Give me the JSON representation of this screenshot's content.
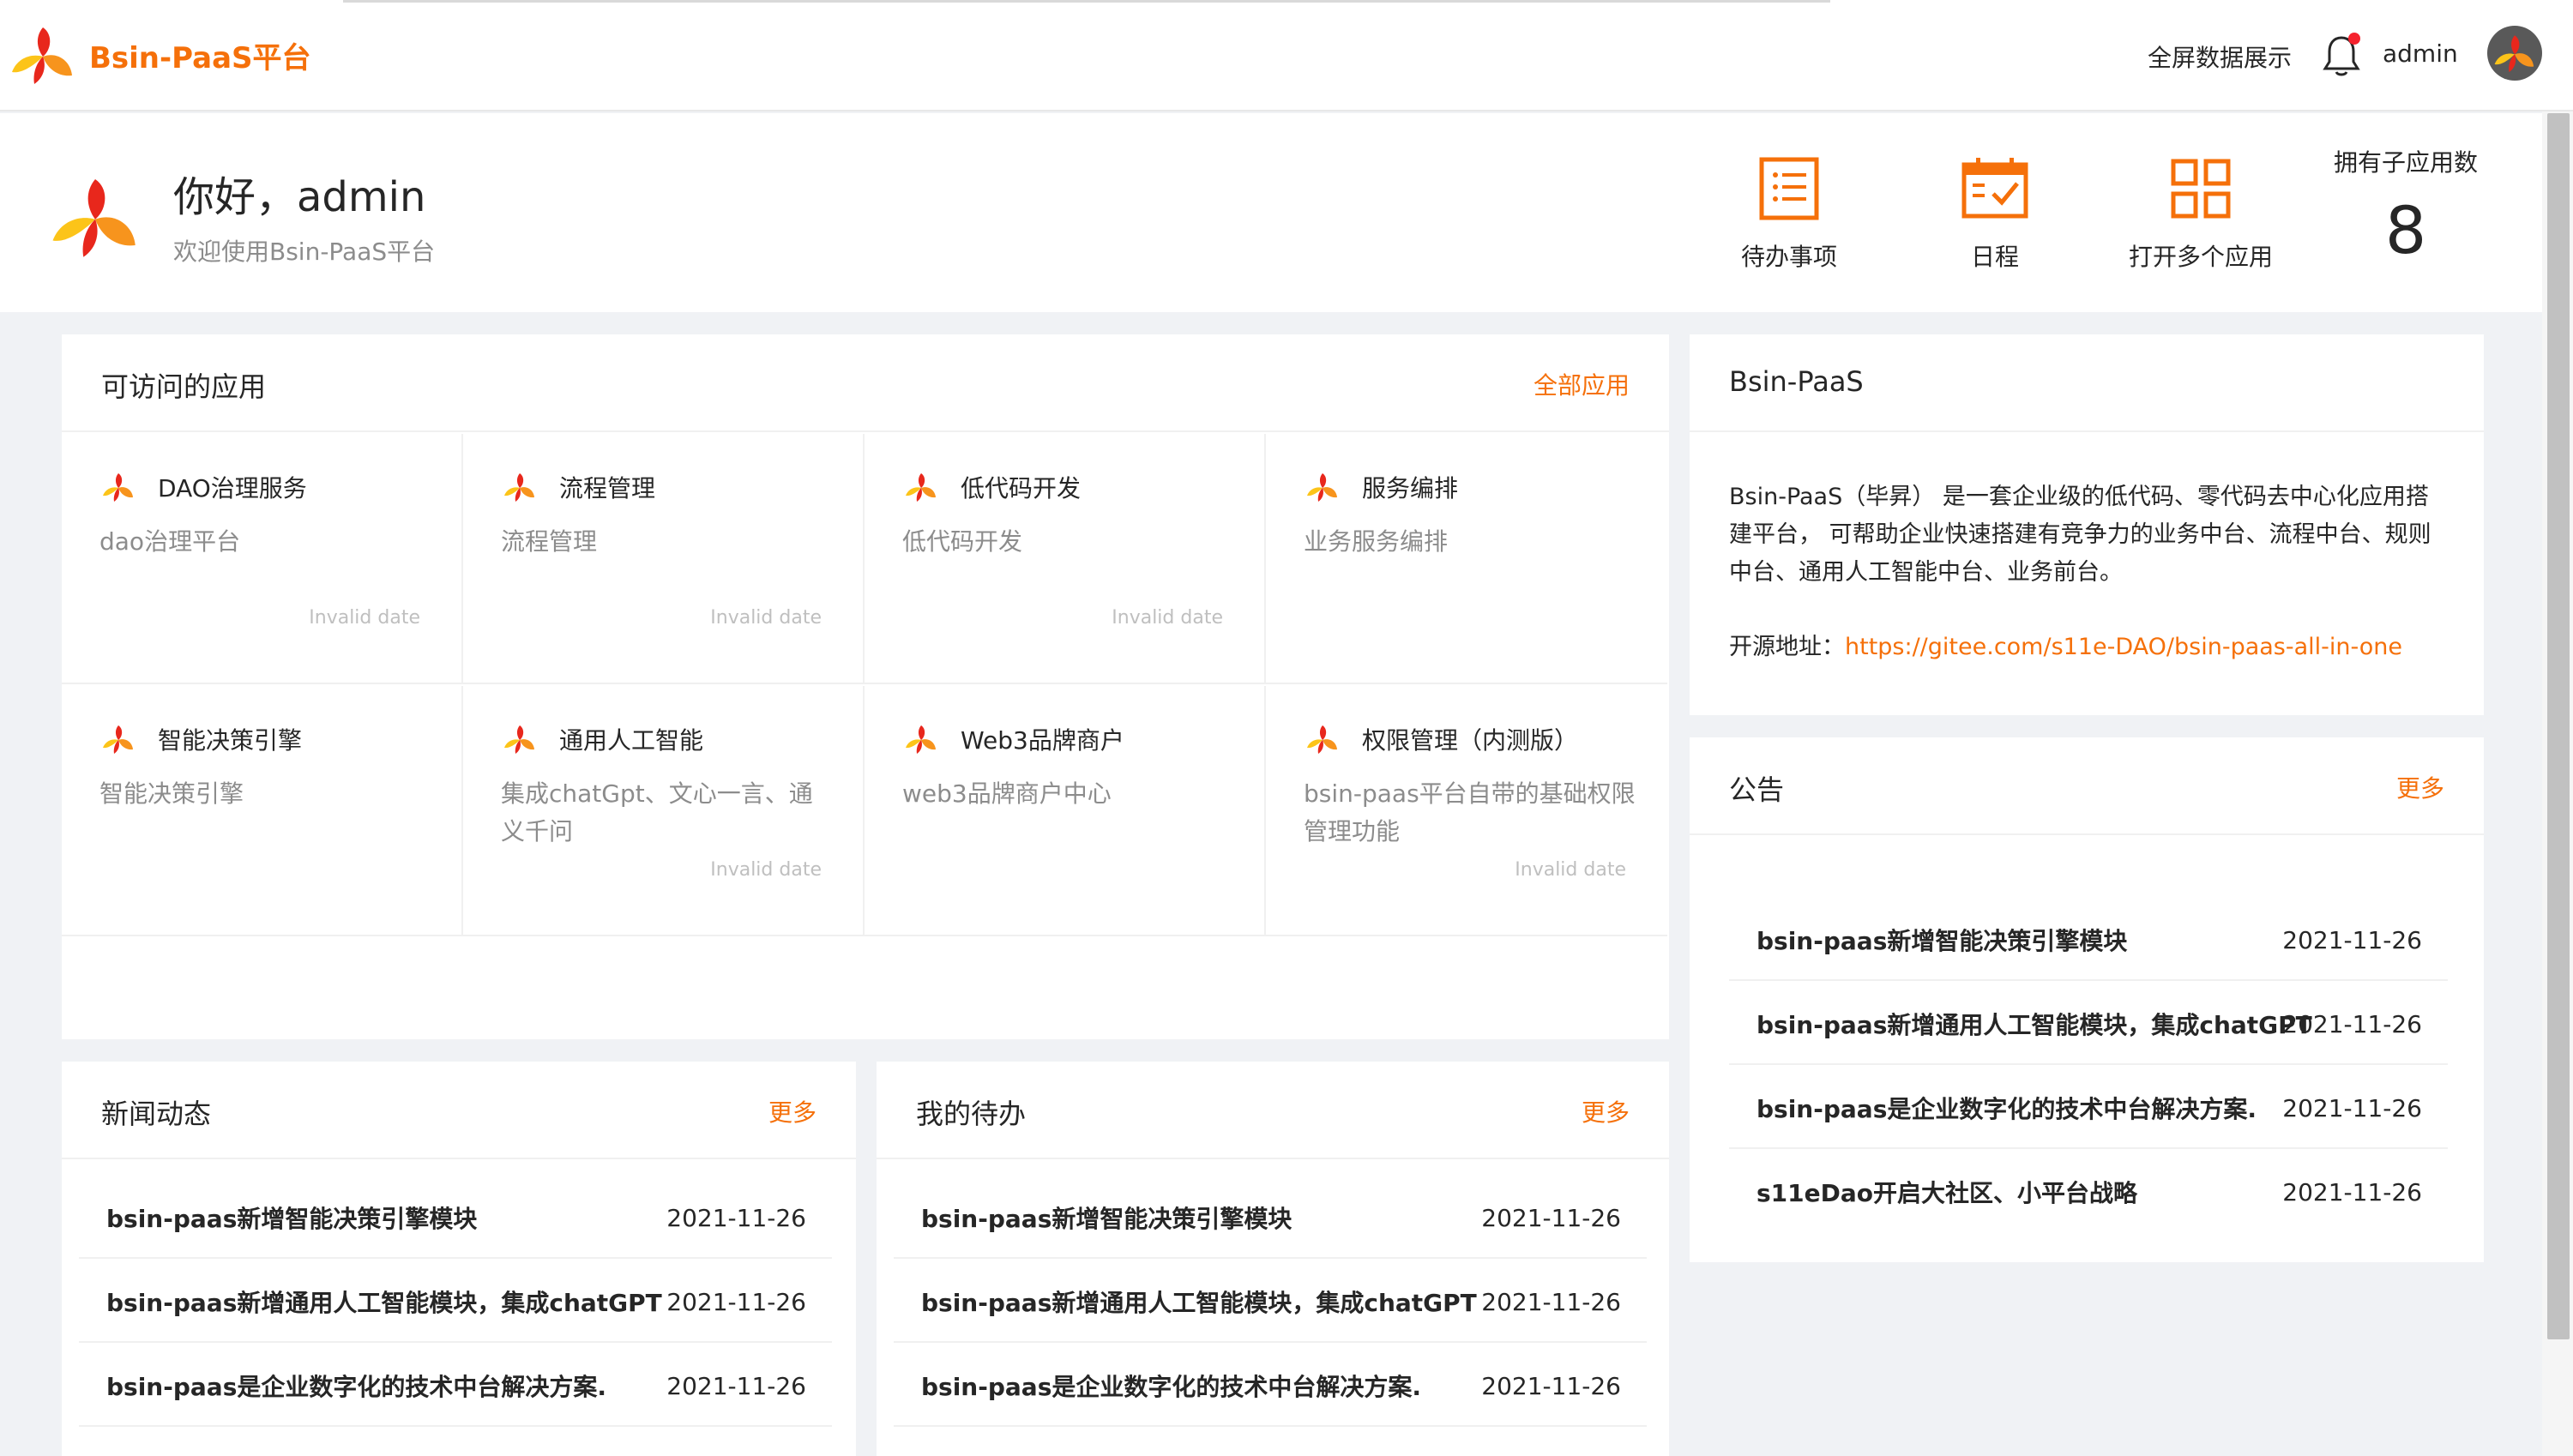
{
  "header": {
    "brand_name": "Bsin-PaaS平台",
    "fullscreen_label": "全屏数据展示",
    "username": "admin"
  },
  "welcome": {
    "greeting": "你好，admin",
    "subtitle": "欢迎使用Bsin-PaaS平台",
    "quick_actions": [
      {
        "label": "待办事项",
        "icon": "todo-list-icon"
      },
      {
        "label": "日程",
        "icon": "calendar-check-icon"
      },
      {
        "label": "打开多个应用",
        "icon": "grid-apps-icon"
      }
    ],
    "subapp_count_label": "拥有子应用数",
    "subapp_count": "8"
  },
  "apps": {
    "title": "可访问的应用",
    "more_label": "全部应用",
    "items": [
      {
        "name": "DAO治理服务",
        "desc": "dao治理平台",
        "date": "Invalid date"
      },
      {
        "name": "流程管理",
        "desc": "流程管理",
        "date": "Invalid date"
      },
      {
        "name": "低代码开发",
        "desc": "低代码开发",
        "date": "Invalid date"
      },
      {
        "name": "服务编排",
        "desc": "业务服务编排",
        "date": ""
      },
      {
        "name": "智能决策引擎",
        "desc": "智能决策引擎",
        "date": ""
      },
      {
        "name": "通用人工智能",
        "desc": "集成chatGpt、文心一言、通义千问",
        "date": "Invalid date"
      },
      {
        "name": "Web3品牌商户",
        "desc": "web3品牌商户中心",
        "date": ""
      },
      {
        "name": "权限管理（内测版）",
        "desc": "bsin-paas平台自带的基础权限管理功能",
        "date": "Invalid date"
      }
    ]
  },
  "about": {
    "title": "Bsin-PaaS",
    "body": "Bsin-PaaS（毕昇） 是一套企业级的低代码、零代码去中心化应用搭建平台， 可帮助企业快速搭建有竞争力的业务中台、流程中台、规则中台、通用人工智能中台、业务前台。",
    "link_label": "开源地址：",
    "link_url": "https://gitee.com/s11e-DAO/bsin-paas-all-in-one"
  },
  "notice": {
    "title": "公告",
    "more_label": "更多",
    "items": [
      {
        "title": "bsin-paas新增智能决策引擎模块",
        "date": "2021-11-26"
      },
      {
        "title": "bsin-paas新增通用人工智能模块，集成chatGPT",
        "date": "2021-11-26"
      },
      {
        "title": "bsin-paas是企业数字化的技术中台解决方案.",
        "date": "2021-11-26"
      },
      {
        "title": "s11eDao开启大社区、小平台战略",
        "date": "2021-11-26"
      }
    ]
  },
  "news": {
    "title": "新闻动态",
    "more_label": "更多",
    "items": [
      {
        "title": "bsin-paas新增智能决策引擎模块",
        "date": "2021-11-26"
      },
      {
        "title": "bsin-paas新增通用人工智能模块，集成chatGPT",
        "date": "2021-11-26"
      },
      {
        "title": "bsin-paas是企业数字化的技术中台解决方案.",
        "date": "2021-11-26"
      }
    ]
  },
  "todo": {
    "title": "我的待办",
    "more_label": "更多",
    "items": [
      {
        "title": "bsin-paas新增智能决策引擎模块",
        "date": "2021-11-26"
      },
      {
        "title": "bsin-paas新增通用人工智能模块，集成chatGPT",
        "date": "2021-11-26"
      },
      {
        "title": "bsin-paas是企业数字化的技术中台解决方案.",
        "date": "2021-11-26"
      }
    ]
  },
  "colors": {
    "accent": "#f5700a",
    "logo_red": "#e8271c",
    "logo_orange": "#f7941d",
    "logo_yellow": "#fcc419"
  }
}
